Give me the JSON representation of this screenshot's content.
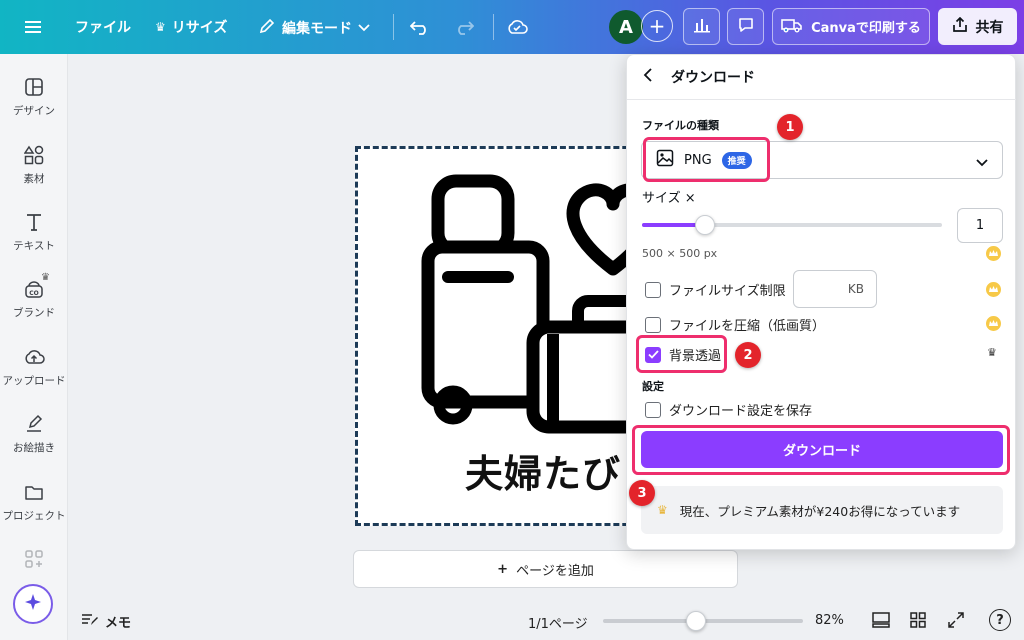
{
  "topbar": {
    "menu_icon": "hamburger-icon",
    "file": "ファイル",
    "resize": "リサイズ",
    "edit_mode": "編集モード",
    "avatar_letter": "A",
    "print_label": "Canvaで印刷する",
    "share_label": "共有"
  },
  "sidebar": {
    "items": [
      {
        "label": "デザイン",
        "icon": "design-icon"
      },
      {
        "label": "素材",
        "icon": "elements-icon"
      },
      {
        "label": "テキスト",
        "icon": "text-icon"
      },
      {
        "label": "ブランド",
        "icon": "brand-icon"
      },
      {
        "label": "アップロード",
        "icon": "upload-icon"
      },
      {
        "label": "お絵描き",
        "icon": "draw-icon"
      },
      {
        "label": "プロジェクト",
        "icon": "folder-icon"
      }
    ]
  },
  "canvas": {
    "design_text": "夫婦たび",
    "add_page": "ページを追加",
    "add_page_prefix": "+"
  },
  "bottombar": {
    "notes": "メモ",
    "page_indicator": "1/1ページ",
    "zoom": "82%",
    "zoom_level": 0.82,
    "help": "?"
  },
  "panel": {
    "title": "ダウンロード",
    "file_type_label": "ファイルの種類",
    "file_type_value": "PNG",
    "recommended_badge": "推奨",
    "size_label": "サイズ ×",
    "size_value": "1",
    "size_slider_fraction": 0.21,
    "dimensions": "500 × 500 px",
    "file_size_limit": "ファイルサイズ制限",
    "kb_unit": "KB",
    "compress": "ファイルを圧縮（低画質）",
    "transparent_bg": "背景透過",
    "settings_label": "設定",
    "save_settings": "ダウンロード設定を保存",
    "download_button": "ダウンロード",
    "promo_text": "現在、プレミアム素材が¥240お得になっています"
  },
  "annotations": {
    "step1": "1",
    "step2": "2",
    "step3": "3"
  },
  "colors": {
    "accent": "#8b3dff",
    "highlight": "#ee2e6d",
    "step_circle": "#e3242b",
    "badge": "#2d66e6"
  }
}
